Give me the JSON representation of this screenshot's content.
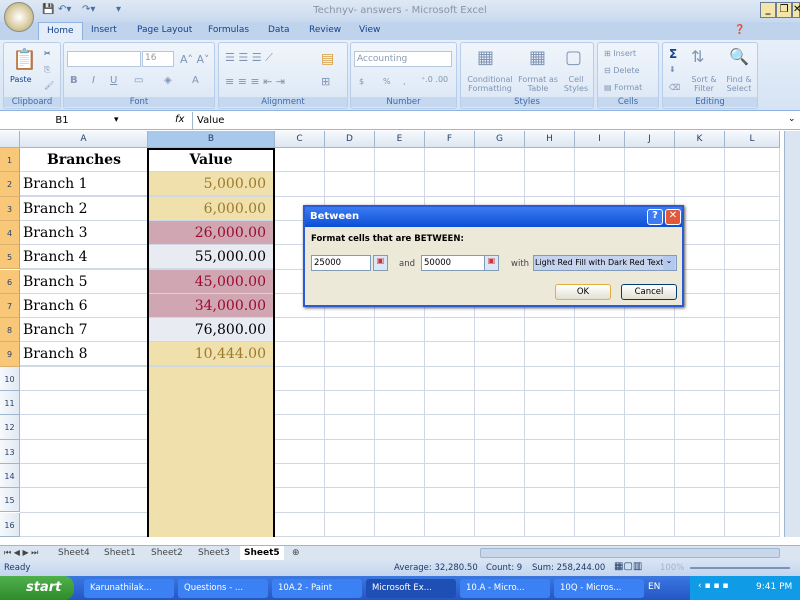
{
  "window": {
    "title": "Technyv- answers - Microsoft Excel",
    "minimize": "_",
    "restore": "❐",
    "close": "✕"
  },
  "ribbon": {
    "tabs": [
      "Home",
      "Insert",
      "Page Layout",
      "Formulas",
      "Data",
      "Review",
      "View"
    ],
    "active_tab": "Home",
    "clipboard": {
      "label": "Clipboard",
      "paste": "Paste"
    },
    "font": {
      "label": "Font",
      "name": "",
      "size": "16",
      "bold": "B",
      "italic": "I",
      "underline": "U"
    },
    "alignment": {
      "label": "Alignment"
    },
    "number": {
      "label": "Number",
      "format": "Accounting",
      "currency": "$",
      "percent": "%",
      "comma": ","
    },
    "styles": {
      "label": "Styles",
      "conditional": "Conditional Formatting",
      "format_table": "Format as Table",
      "cell_styles": "Cell Styles"
    },
    "cells": {
      "label": "Cells",
      "insert": "Insert",
      "delete": "Delete",
      "format": "Format"
    },
    "editing": {
      "label": "Editing",
      "sum": "Σ",
      "sort": "Sort & Filter",
      "find": "Find & Select"
    }
  },
  "formula_bar": {
    "name_box": "B1",
    "fx": "fx",
    "value": "Value"
  },
  "columns": [
    "A",
    "B",
    "C",
    "D",
    "E",
    "F",
    "G",
    "H",
    "I",
    "J",
    "K",
    "L"
  ],
  "rows": [
    "1",
    "2",
    "3",
    "4",
    "5",
    "6",
    "7",
    "8",
    "9",
    "10",
    "11",
    "12",
    "13",
    "14",
    "15",
    "16"
  ],
  "table": {
    "headers": [
      "Branches",
      "Value"
    ],
    "rows": [
      {
        "branch": "Branch 1",
        "value": "5,000.00",
        "style": "yellow"
      },
      {
        "branch": "Branch 2",
        "value": "6,000.00",
        "style": "yellow"
      },
      {
        "branch": "Branch 3",
        "value": "26,000.00",
        "style": "red"
      },
      {
        "branch": "Branch 4",
        "value": "55,000.00",
        "style": "plain"
      },
      {
        "branch": "Branch 5",
        "value": "45,000.00",
        "style": "red"
      },
      {
        "branch": "Branch 6",
        "value": "34,000.00",
        "style": "red"
      },
      {
        "branch": "Branch 7",
        "value": "76,800.00",
        "style": "plain"
      },
      {
        "branch": "Branch 8",
        "value": "10,444.00",
        "style": "yellow"
      }
    ]
  },
  "colors": {
    "yellow_fill": "#f0e0ab",
    "yellow_text": "#9c7a2e",
    "red_fill": "#cfa6b2",
    "red_text": "#9c0a30",
    "plain_fill": "#e8ebf2",
    "accent": "#15428b"
  },
  "dialog": {
    "title": "Between",
    "prompt": "Format cells that are BETWEEN:",
    "min": "25000",
    "and": "and",
    "max": "50000",
    "with": "with",
    "format": "Light Red Fill with Dark Red Text",
    "ok": "OK",
    "cancel": "Cancel",
    "help": "?",
    "close": "✕"
  },
  "sheets": {
    "tabs": [
      "Sheet4",
      "Sheet1",
      "Sheet2",
      "Sheet3",
      "Sheet5"
    ],
    "active": "Sheet5"
  },
  "status": {
    "ready": "Ready",
    "average": "Average: 32,280.50",
    "count": "Count: 9",
    "sum": "Sum: 258,244.00",
    "zoom": "100%"
  },
  "taskbar": {
    "start": "start",
    "items": [
      "Karunathilak...",
      "Questions - ...",
      "10A.2 - Paint",
      "Microsoft Ex...",
      "10.A - Micro...",
      "10Q - Micros..."
    ],
    "lang": "EN",
    "time": "9:41 PM"
  }
}
